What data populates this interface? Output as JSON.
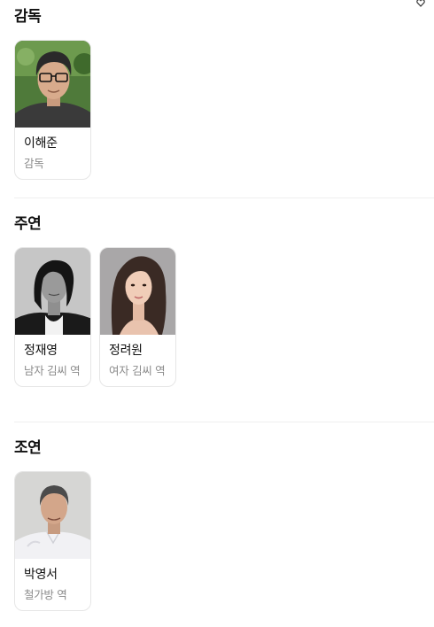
{
  "sections": [
    {
      "title": "감독",
      "people": [
        {
          "name": "이해준",
          "role": "감독"
        }
      ]
    },
    {
      "title": "주연",
      "people": [
        {
          "name": "정재영",
          "role": "남자 김씨 역"
        },
        {
          "name": "정려원",
          "role": "여자 김씨 역"
        }
      ]
    },
    {
      "title": "조연",
      "people": [
        {
          "name": "박영서",
          "role": "철가방 역"
        }
      ]
    }
  ],
  "icons": {
    "corner": "heart-outline-icon"
  },
  "colors": {
    "text": "#111111",
    "muted": "#8a8a8a",
    "border": "#e6e6e6",
    "divider": "#efefef"
  }
}
